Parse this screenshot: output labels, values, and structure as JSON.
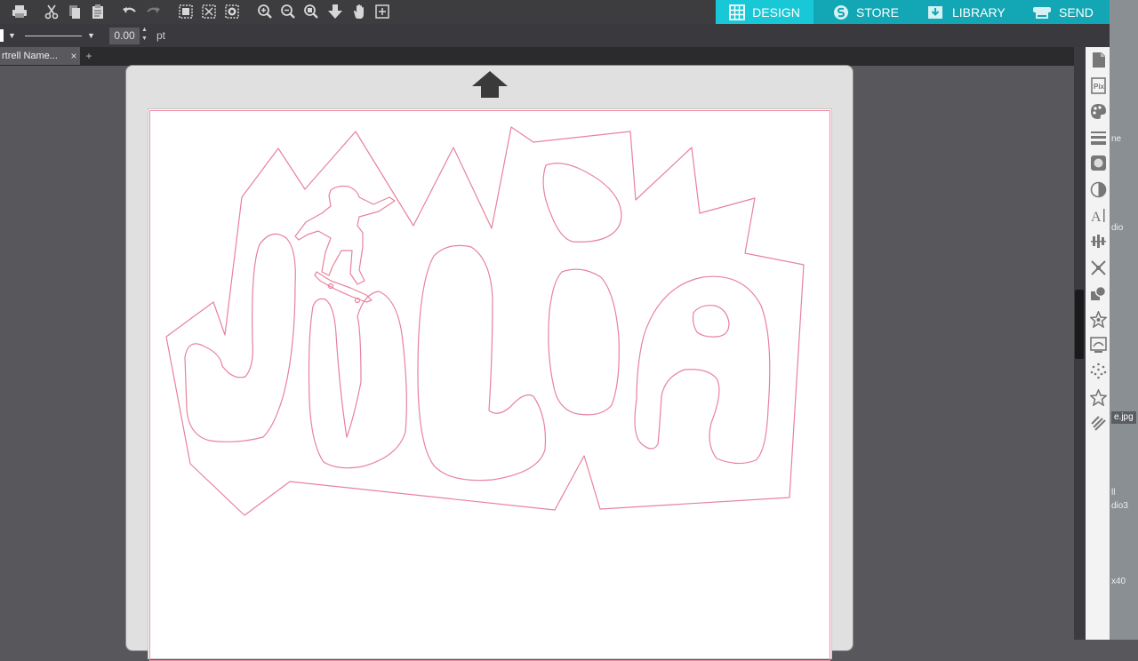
{
  "toolbar": {
    "icons": [
      "print-icon",
      "cut-icon",
      "copy-icon",
      "paste-icon",
      "undo-icon",
      "redo-icon",
      "group-icon",
      "ungroup-icon",
      "release-compound-icon",
      "zoom-in-icon",
      "zoom-out-icon",
      "zoom-fit-icon",
      "pan-down-icon",
      "hand-icon",
      "fit-to-page-icon"
    ]
  },
  "nav": {
    "design": "DESIGN",
    "store": "STORE",
    "library": "LIBRARY",
    "send": "SEND"
  },
  "line_props": {
    "width_value": "0.00",
    "unit": "pt"
  },
  "tabs": [
    {
      "label": "rtrell Name..."
    }
  ],
  "tab_close": "×",
  "tab_add": "+",
  "canvas": {
    "cut_line_color": "#e8829d",
    "design_word": "JULIA"
  },
  "right_panel": {
    "icons": [
      "page-setup-icon",
      "pixscan-icon",
      "fill-color-icon",
      "line-style-icon",
      "image-effects-icon",
      "contrast-icon",
      "text-style-icon",
      "align-icon",
      "replicate-icon",
      "modify-icon",
      "offset-icon",
      "trace-icon",
      "sketch-icon",
      "star-icon",
      "cut-settings-icon"
    ]
  },
  "desktop": {
    "labels": [
      "ne",
      "dio",
      "jpg",
      "ll",
      "dio3",
      "x40"
    ],
    "file_label": "e.jpg"
  },
  "colors": {
    "design_tab": "#19c8d6",
    "nav_bar": "#13a6b4",
    "toolbar_bg": "#3d3d40",
    "workspace_bg": "#58575c"
  }
}
